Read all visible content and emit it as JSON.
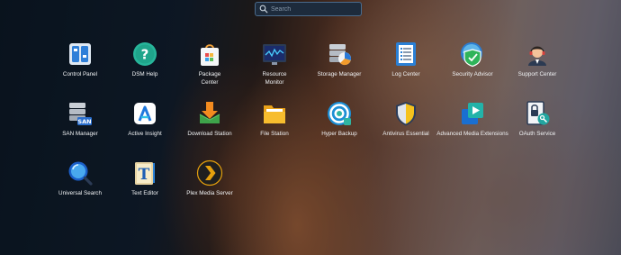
{
  "search": {
    "placeholder": "Search",
    "icon": "search-icon"
  },
  "apps": [
    {
      "label": "Control Panel",
      "icon": "control-panel-icon"
    },
    {
      "label": "DSM Help",
      "icon": "help-icon"
    },
    {
      "label": "Package\nCenter",
      "icon": "package-center-icon"
    },
    {
      "label": "Resource\nMonitor",
      "icon": "resource-monitor-icon"
    },
    {
      "label": "Storage Manager",
      "icon": "storage-manager-icon"
    },
    {
      "label": "Log Center",
      "icon": "log-center-icon"
    },
    {
      "label": "Security Advisor",
      "icon": "security-advisor-icon"
    },
    {
      "label": "Support Center",
      "icon": "support-center-icon"
    },
    {
      "label": "SAN Manager",
      "icon": "san-manager-icon",
      "badge": "SAN"
    },
    {
      "label": "Active Insight",
      "icon": "active-insight-icon"
    },
    {
      "label": "Download Station",
      "icon": "download-station-icon"
    },
    {
      "label": "File Station",
      "icon": "file-station-icon"
    },
    {
      "label": "Hyper Backup",
      "icon": "hyper-backup-icon"
    },
    {
      "label": "Antivirus Essential",
      "icon": "antivirus-icon"
    },
    {
      "label": "Advanced Media Extensions",
      "icon": "media-extensions-icon"
    },
    {
      "label": "OAuth Service",
      "icon": "oauth-service-icon"
    },
    {
      "label": "Universal Search",
      "icon": "universal-search-icon"
    },
    {
      "label": "Text Editor",
      "icon": "text-editor-icon",
      "badge": "T"
    },
    {
      "label": "Plex Media Server",
      "icon": "plex-icon"
    }
  ]
}
